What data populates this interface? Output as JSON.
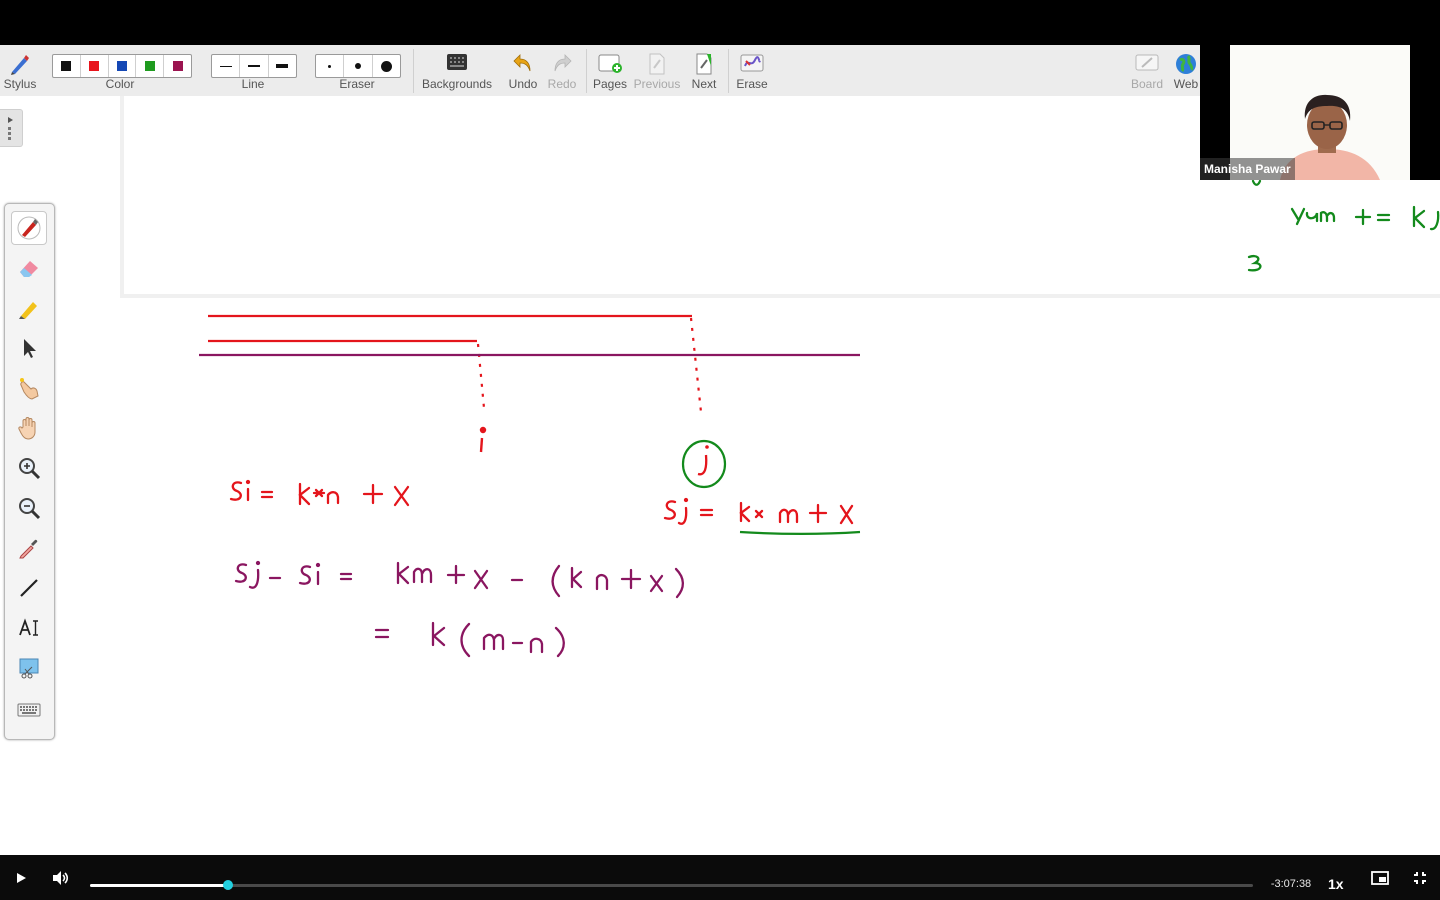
{
  "toolbar": {
    "stylus": "Stylus",
    "color": "Color",
    "line": "Line",
    "eraser": "Eraser",
    "backgrounds": "Backgrounds",
    "undo": "Undo",
    "redo": "Redo",
    "pages": "Pages",
    "previous": "Previous",
    "next": "Next",
    "erase": "Erase",
    "board": "Board",
    "web": "Web",
    "colors": [
      "#111111",
      "#e8141c",
      "#1548b5",
      "#1f9b1f",
      "#9b1450"
    ]
  },
  "webcam": {
    "name": "Manisha Pawar"
  },
  "player": {
    "time_remaining": "-3:07:38",
    "speed": "1x",
    "progress_fraction": 0.119
  },
  "colors": {
    "red_ink": "#e4151c",
    "purple_ink": "#8a1660",
    "green_ink": "#138a1c",
    "accent": "#22d0e0"
  }
}
